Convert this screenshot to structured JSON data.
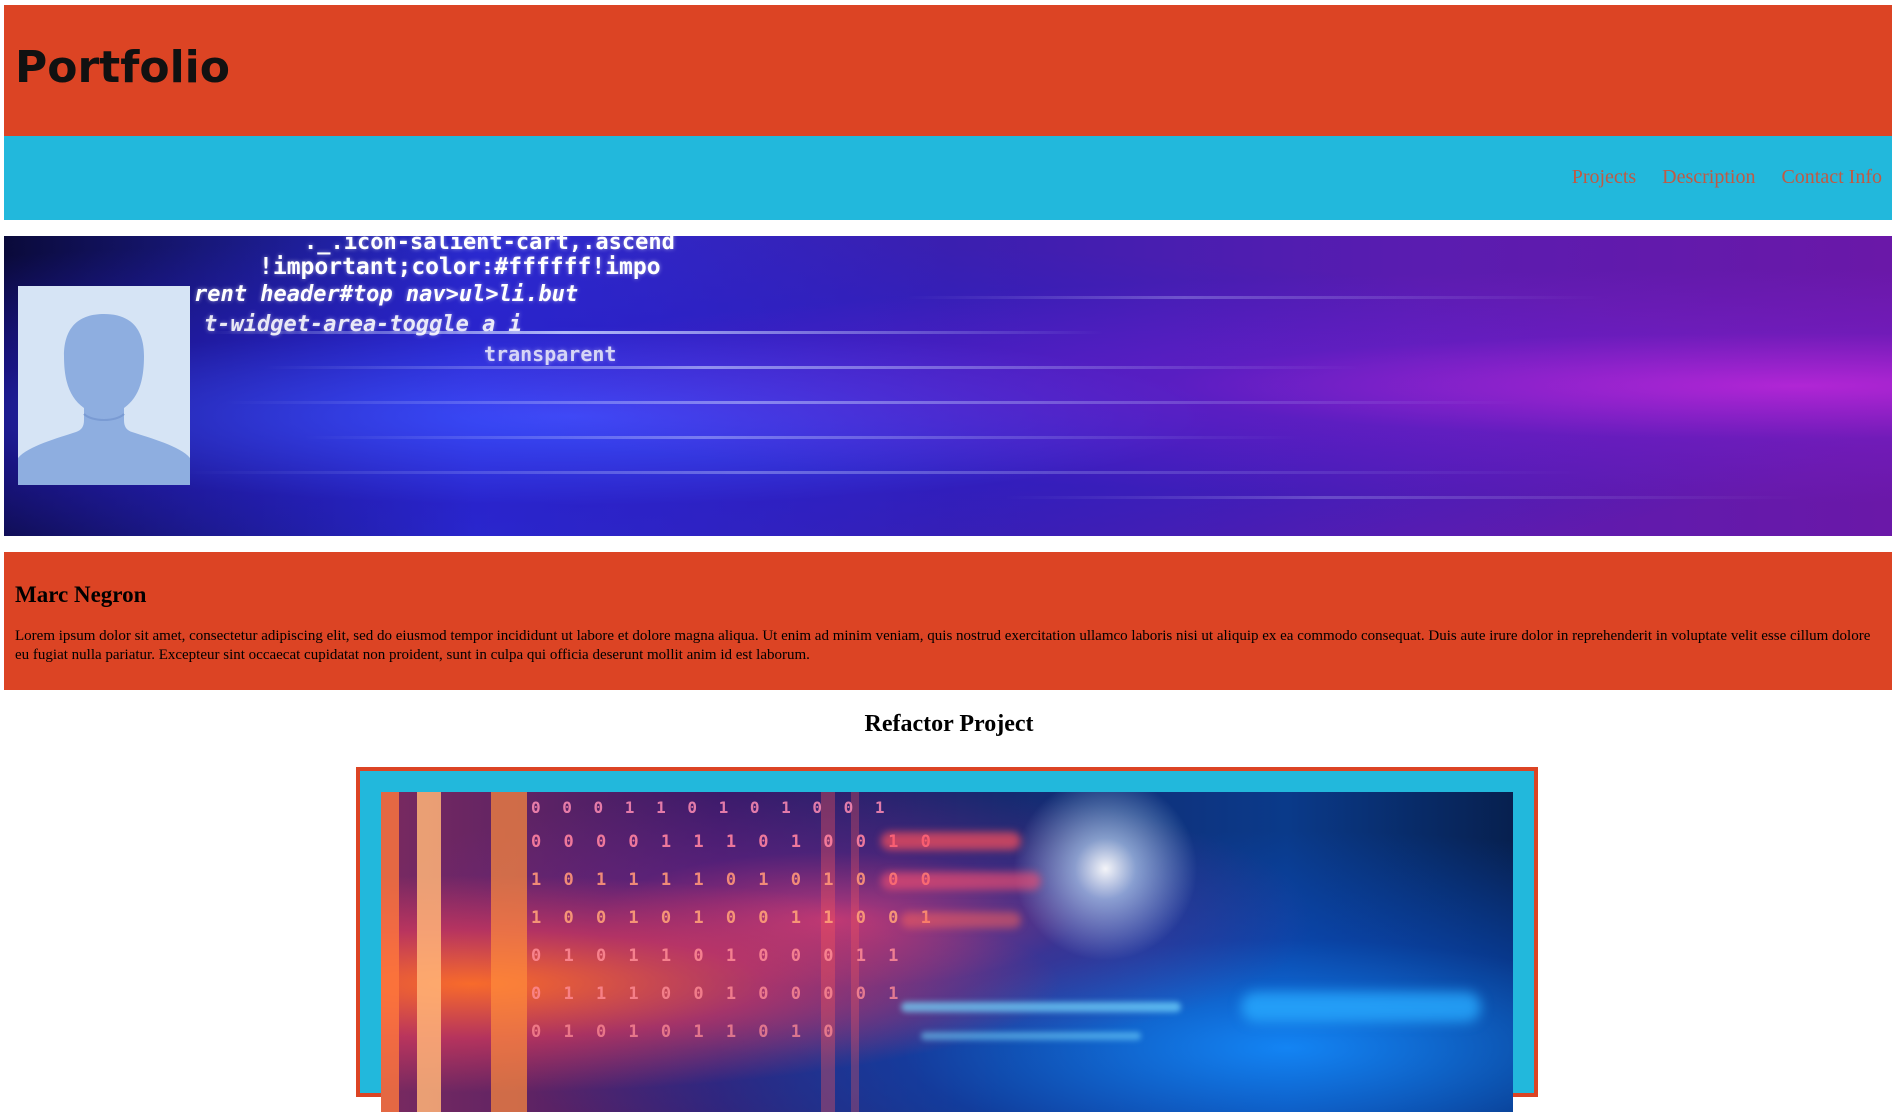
{
  "site": {
    "title": "Portfolio"
  },
  "nav": {
    "items": [
      {
        "label": "Projects"
      },
      {
        "label": "Description"
      },
      {
        "label": "Contact Info"
      }
    ]
  },
  "hero": {
    "code_lines": [
      "._.icon-salient-cart,.ascend",
      "!important;color:#ffffff!impo",
      "rent header#top nav>ul>li.but",
      "t-widget-area-toggle a i",
      "transparent"
    ]
  },
  "about": {
    "name": "Marc Negron",
    "bio": "Lorem ipsum dolor sit amet, consectetur adipiscing elit, sed do eiusmod tempor incididunt ut labore et dolore magna aliqua. Ut enim ad minim veniam, quis nostrud exercitation ullamco laboris nisi ut aliquip ex ea commodo consequat. Duis aute irure dolor in reprehenderit in voluptate velit esse cillum dolore eu fugiat nulla pariatur. Excepteur sint occaecat cupidatat non proident, sunt in culpa qui officia deserunt mollit anim id est laborum."
  },
  "project": {
    "title": "Refactor Project",
    "bits_rows": [
      "0 0 0 1 1 0 1 0 1 0 0 1",
      "0 0 0 0 1 1 1 0 1 0 0 1 0",
      "1 0 1 1 1 1 0 1 0 1 0 0 0",
      "1 0 0 1 0 1 0 0 1 1 0 0 1",
      "0 1 0 1 1 0 1 0 0 0 1 1",
      "0 1 1 1 0 0 1 0 0 0 0 1",
      "0 1 0 1 0 1 1 0 1 0"
    ]
  },
  "colors": {
    "header_bg": "#dc4424",
    "nav_bg": "#22b8dc",
    "nav_link": "#c05a44",
    "about_bg": "#dc4424",
    "frame_border": "#dc4424",
    "frame_bg": "#22b8dc"
  }
}
